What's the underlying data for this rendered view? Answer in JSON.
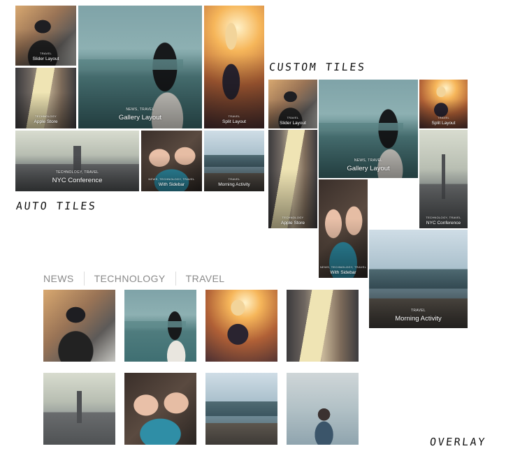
{
  "sections": {
    "custom_tiles": "CUSTOM TILES",
    "auto_tiles": "AUTO TILES",
    "overlay": "OVERLAY"
  },
  "auto_tiles": [
    {
      "category": "TRAVEL",
      "title": "Slider Layout",
      "photo": "vr-headset"
    },
    {
      "category": "NEWS, TRAVEL",
      "title": "Gallery Layout",
      "photo": "blindfold-sea"
    },
    {
      "category": "TRAVEL",
      "title": "Split Layout",
      "photo": "sunset-girl"
    },
    {
      "category": "TECHNOLOGY",
      "title": "Apple Store",
      "photo": "apple-store"
    },
    {
      "category": "TECHNOLOGY, TRAVEL",
      "title": "NYC Conference",
      "photo": "nyc-skyline"
    },
    {
      "category": "NEWS, TECHNOLOGY, TRAVEL",
      "title": "With Sidebar",
      "photo": "knitting"
    },
    {
      "category": "TRAVEL",
      "title": "Morning Activity",
      "photo": "mountain-hikers"
    }
  ],
  "custom_tiles": [
    {
      "category": "TRAVEL",
      "title": "Slider Layout"
    },
    {
      "category": "NEWS, TRAVEL",
      "title": "Gallery Layout"
    },
    {
      "category": "TRAVEL",
      "title": "Split Layout"
    },
    {
      "category": "TECHNOLOGY",
      "title": "Apple Store"
    },
    {
      "category": "TECHNOLOGY, TRAVEL",
      "title": "NYC Conference"
    },
    {
      "category": "NEWS, TECHNOLOGY, TRAVEL",
      "title": "With Sidebar"
    },
    {
      "category": "TRAVEL",
      "title": "Morning Activity"
    }
  ],
  "filters": [
    "NEWS",
    "TECHNOLOGY",
    "TRAVEL"
  ],
  "overlay_grid": [
    "vr-headset",
    "blindfold-sea",
    "sunset-girl",
    "apple-store",
    "nyc-skyline",
    "knitting",
    "mountain-hikers",
    "foggy-traveler"
  ]
}
